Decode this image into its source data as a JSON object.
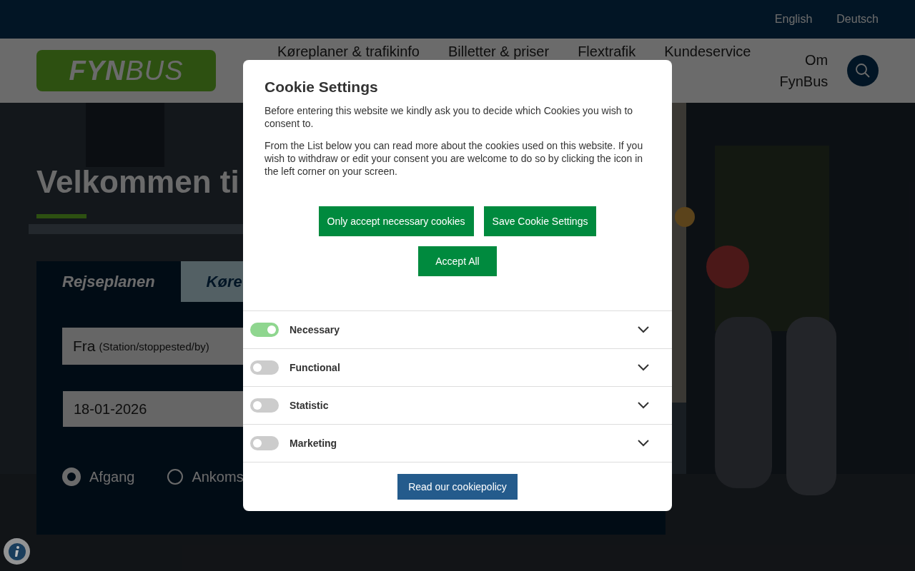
{
  "language_links": [
    {
      "label": "English"
    },
    {
      "label": "Deutsch"
    }
  ],
  "header": {
    "logo": "**FYN**BUS",
    "nav": [
      "Køreplaner & trafikinfo",
      "Billetter & priser",
      "Flextrafik",
      "Kundeservice",
      "Om FynBus"
    ]
  },
  "hero": {
    "title": "Velkommen ti",
    "tabs": [
      {
        "label": "Rejseplanen",
        "selected": true
      },
      {
        "label": "Køre",
        "selected": false
      }
    ],
    "from_field": {
      "label": "Fra",
      "placeholder": "(Station/stoppested/by)"
    },
    "date_field": {
      "value": "18-01-2026"
    },
    "radios": [
      {
        "label": "Afgang",
        "selected": true
      },
      {
        "label": "Ankoms",
        "selected": false
      }
    ]
  },
  "cookie_dialog": {
    "title": "Cookie Settings",
    "paragraphs": [
      "Before entering this website we kindly ask you to decide which Cookies you wish to consent to.",
      "From the List below you can read more about the cookies used on this website. If you wish to withdraw or edit your consent you are welcome to do so by clicking the icon in the left corner on your screen."
    ],
    "buttons": [
      "Only accept necessary cookies",
      "Save Cookie Settings",
      "Accept All"
    ],
    "categories": [
      {
        "name": "Necessary",
        "on": true
      },
      {
        "name": "Functional",
        "on": false
      },
      {
        "name": "Statistic",
        "on": false
      },
      {
        "name": "Marketing",
        "on": false
      }
    ],
    "policy_button": "Read our cookiepolicy"
  }
}
